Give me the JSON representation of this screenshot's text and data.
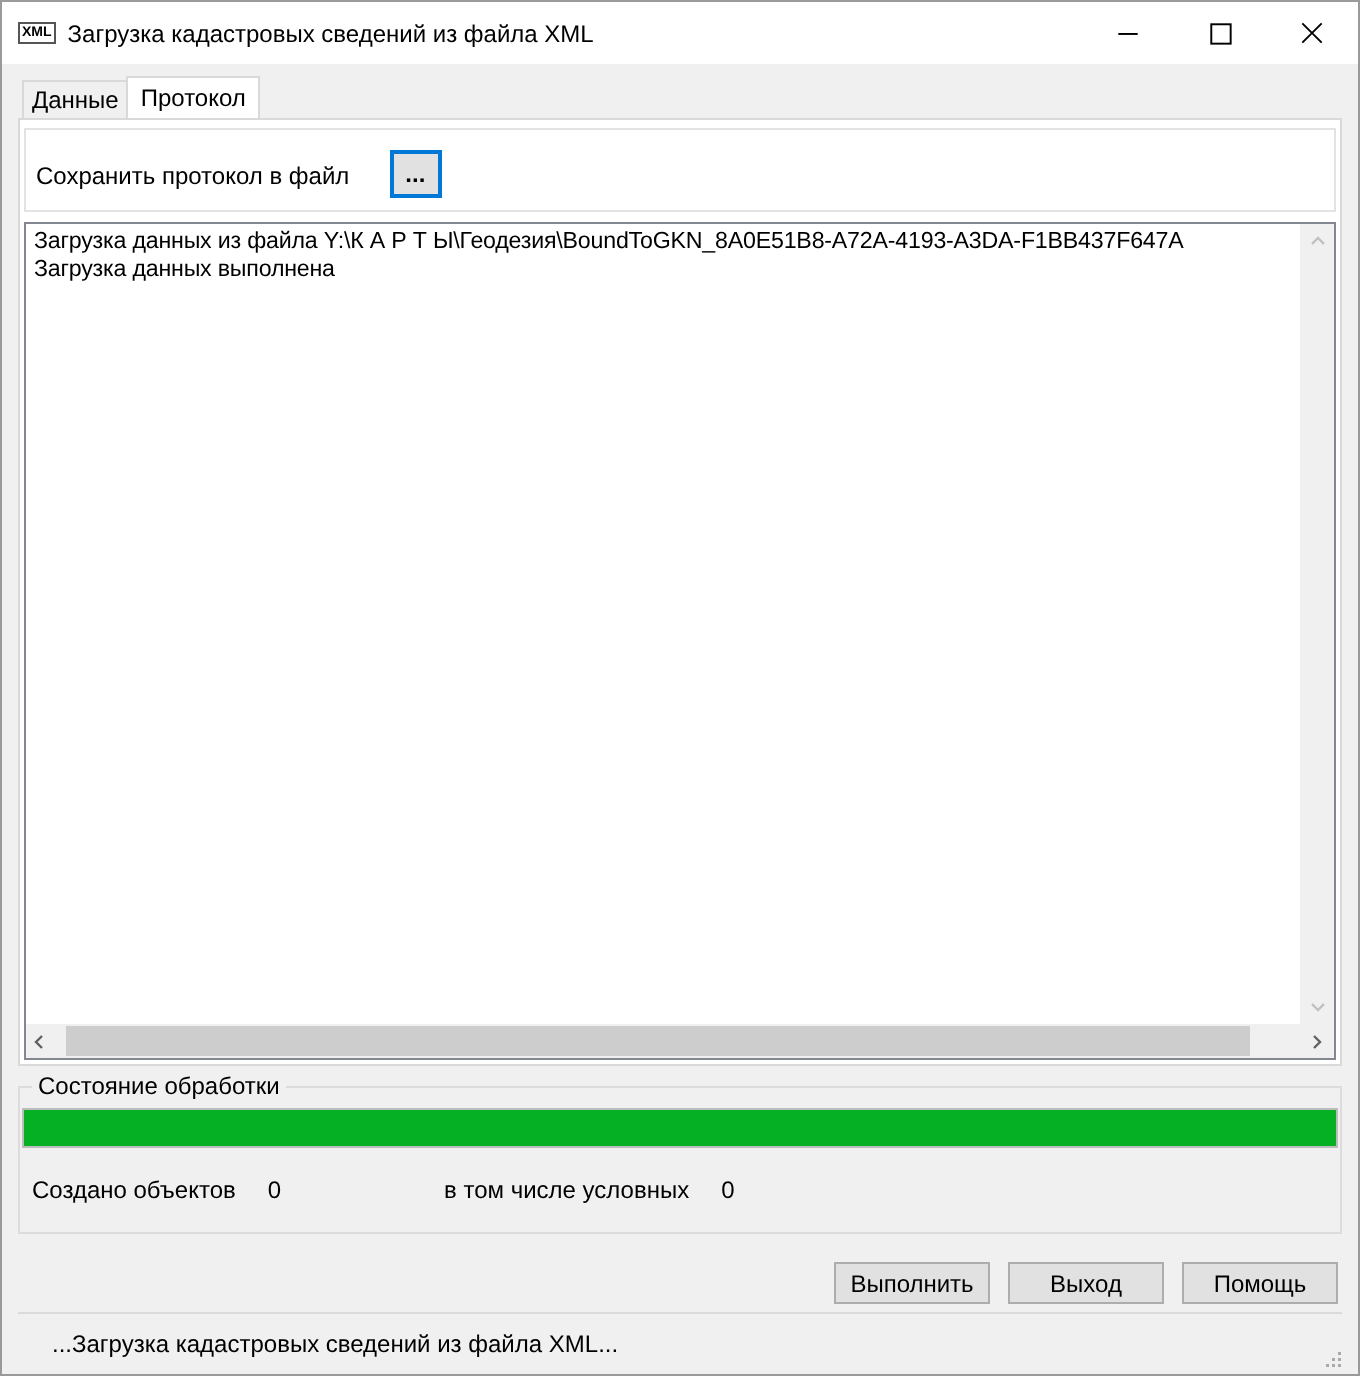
{
  "window": {
    "icon_label": "XML",
    "title": "Загрузка кадастровых сведений из файла XML"
  },
  "tabs": [
    {
      "label": "Данные",
      "selected": false
    },
    {
      "label": "Протокол",
      "selected": true
    }
  ],
  "save_row": {
    "label": "Сохранить протокол в файл",
    "button": "...",
    "focused": true
  },
  "log": {
    "lines": [
      "Загрузка данных из файла Y:\\К А Р Т Ы\\Геодезия\\BoundToGKN_8A0E51B8-A72A-4193-A3DA-F1BB437F647A",
      "Загрузка данных выполнена"
    ]
  },
  "status_group": {
    "title": "Состояние обработки",
    "progress": {
      "level": 1.0
    },
    "counters": [
      {
        "label": "Создано объектов",
        "value": "0"
      },
      {
        "label": "в том числе условных",
        "value": "0"
      }
    ]
  },
  "buttons": [
    "Выполнить",
    "Выход",
    "Помощь"
  ],
  "status_bar": {
    "text": "...Загрузка кадастровых сведений из файла XML..."
  }
}
